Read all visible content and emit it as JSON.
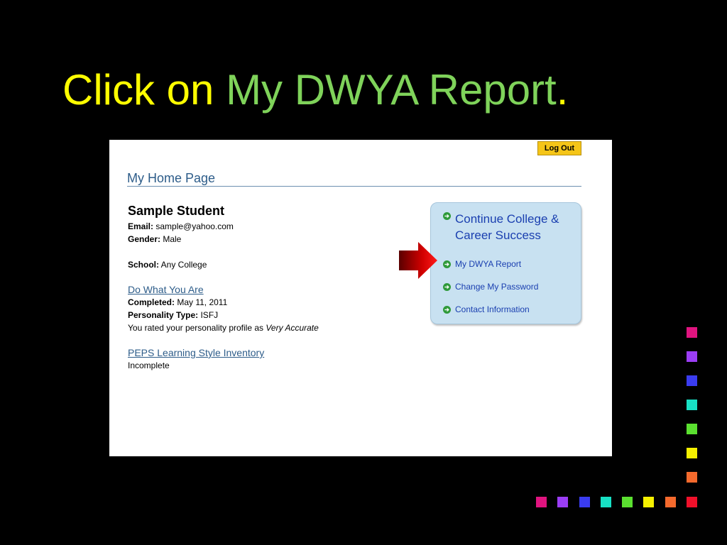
{
  "slide": {
    "title_prefix": "Click on ",
    "title_highlight": "My DWYA Report",
    "title_suffix": "."
  },
  "page": {
    "logout_label": "Log Out",
    "title": "My Home Page"
  },
  "profile": {
    "name": "Sample Student",
    "email_label": "Email:",
    "email": " sample@yahoo.com",
    "gender_label": "Gender:",
    "gender": " Male",
    "school_label": "School:",
    "school": " Any College",
    "dwya_link": "Do What You Are",
    "completed_label": "Completed:",
    "completed": " May 11, 2011",
    "ptype_label": "Personality Type:",
    "ptype": " ISFJ",
    "rated_text": "You rated your personality profile as ",
    "rated_value": "Very Accurate",
    "peps_link": "PEPS Learning Style Inventory",
    "peps_status": "Incomplete"
  },
  "panel": {
    "heading": "Continue College & Career Success",
    "items": [
      "My DWYA Report",
      "Change My Password",
      "Contact Information"
    ]
  },
  "colors": {
    "title_yellow": "#ffff00",
    "title_green": "#7fd35a",
    "logout_bg": "#f5c518",
    "link_blue": "#2d5c89",
    "panel_bg": "#c8e1f1",
    "pointer_red": "#e00000",
    "decor_squares": [
      "#e0147f",
      "#9b3df5",
      "#3a3cf0",
      "#18e0c4",
      "#5be030",
      "#f5f000",
      "#f56a2d",
      "#f0102a"
    ]
  },
  "icons": {
    "panel_bullet": "green-circle-arrow-icon",
    "pointer": "red-arrow-icon"
  }
}
